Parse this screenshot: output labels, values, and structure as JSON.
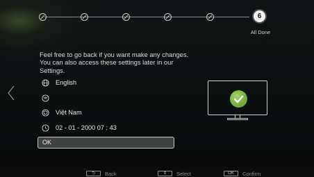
{
  "wizard": {
    "steps_completed": 5,
    "current_step": "6",
    "current_step_label": "All Done"
  },
  "summary": {
    "intro_text": "Feel free to go back if you want make any changes. You can also access these settings later in our Settings.",
    "language": "English",
    "country": "Việt Nam",
    "datetime": "02 - 01 - 2000 07 : 43",
    "ok_button_label": "OK"
  },
  "icons": {
    "language": "globe-icon",
    "network": "network-icon",
    "country": "location-icon",
    "time": "clock-icon",
    "back_nav": "chevron-left-icon",
    "status": "checkmark-icon"
  },
  "colors": {
    "accent_check": "#79b040",
    "ok_box_bg": "#6e736e",
    "text": "#e8e8e8"
  },
  "footer": {
    "back_key": "⮌",
    "back_label": "Back",
    "select_key": "⇕",
    "select_label": "Select",
    "confirm_key": "OK",
    "confirm_label": "Confirm"
  }
}
